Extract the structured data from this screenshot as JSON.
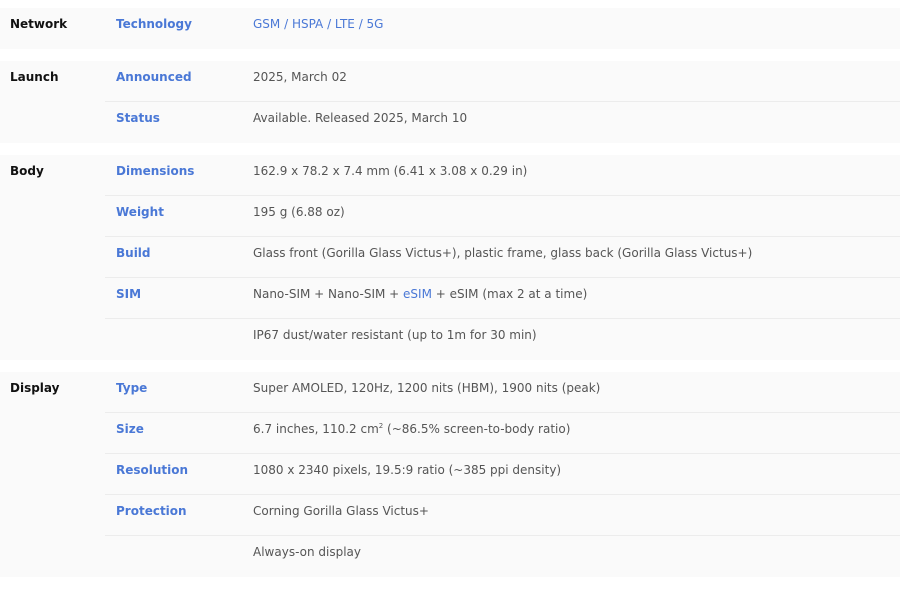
{
  "sections": [
    {
      "title": "Network",
      "rows": [
        {
          "label": "Technology",
          "value": "GSM / HSPA / LTE / 5G",
          "link": true
        }
      ]
    },
    {
      "title": "Launch",
      "rows": [
        {
          "label": "Announced",
          "value": "2025, March 02"
        },
        {
          "label": "Status",
          "value": "Available. Released 2025, March 10"
        }
      ]
    },
    {
      "title": "Body",
      "rows": [
        {
          "label": "Dimensions",
          "value": "162.9 x 78.2 x 7.4 mm (6.41 x 3.08 x 0.29 in)"
        },
        {
          "label": "Weight",
          "value": "195 g (6.88 oz)"
        },
        {
          "label": "Build",
          "value": "Glass front (Gorilla Glass Victus+), plastic frame, glass back (Gorilla Glass Victus+)"
        },
        {
          "label": "SIM",
          "value_parts": [
            "Nano-SIM + Nano-SIM + ",
            "eSIM",
            " + eSIM (max 2 at a time)"
          ]
        },
        {
          "label": "",
          "value": "IP67 dust/water resistant (up to 1m for 30 min)"
        }
      ]
    },
    {
      "title": "Display",
      "rows": [
        {
          "label": "Type",
          "value": "Super AMOLED, 120Hz, 1200 nits (HBM), 1900 nits (peak)"
        },
        {
          "label": "Size",
          "value_parts": [
            "6.7 inches, 110.2 cm",
            "2",
            " (~86.5% screen-to-body ratio)"
          ]
        },
        {
          "label": "Resolution",
          "value": "1080 x 2340 pixels, 19.5:9 ratio (~385 ppi density)"
        },
        {
          "label": "Protection",
          "value": "Corning Gorilla Glass Victus+"
        },
        {
          "label": "",
          "value": "Always-on display"
        }
      ]
    }
  ]
}
